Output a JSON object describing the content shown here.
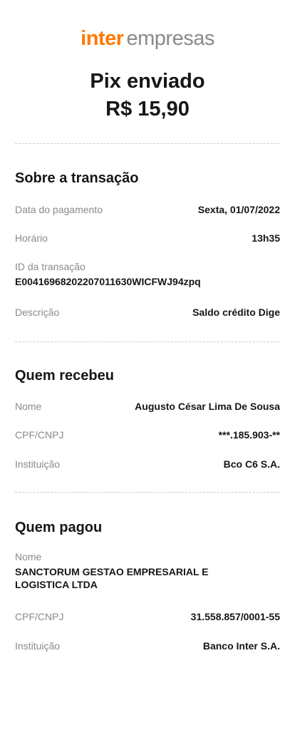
{
  "header": {
    "brand_primary": "inter",
    "brand_secondary": "empresas",
    "title": "Pix enviado",
    "amount": "R$ 15,90"
  },
  "colors": {
    "brand_orange": "#ff7a00",
    "label_gray": "#8a8a8e",
    "text_dark": "#161616"
  },
  "transaction": {
    "section_title": "Sobre a transação",
    "payment_date_label": "Data do pagamento",
    "payment_date": "Sexta, 01/07/2022",
    "time_label": "Horário",
    "time": "13h35",
    "id_label": "ID da transação",
    "id": "E00416968202207011630WICFWJ94zpq",
    "description_label": "Descrição",
    "description": "Saldo crédito Dige"
  },
  "receiver": {
    "section_title": "Quem recebeu",
    "name_label": "Nome",
    "name": "Augusto César Lima De Sousa",
    "doc_label": "CPF/CNPJ",
    "doc": "***.185.903-**",
    "institution_label": "Instituição",
    "institution": "Bco C6 S.A."
  },
  "payer": {
    "section_title": "Quem pagou",
    "name_label": "Nome",
    "name": "SANCTORUM GESTAO EMPRESARIAL E LOGISTICA LTDA",
    "doc_label": "CPF/CNPJ",
    "doc": "31.558.857/0001-55",
    "institution_label": "Instituição",
    "institution": "Banco Inter S.A."
  }
}
